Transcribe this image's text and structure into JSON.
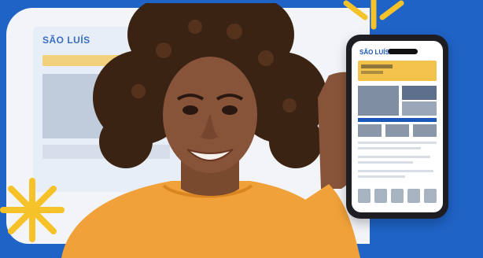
{
  "scene": {
    "background_color": "#1f63c6",
    "panel_color": "#f2f4f8",
    "accent_color": "#f6c229",
    "sweater_color": "#f0a13a"
  },
  "website": {
    "logo_text": "SÃO LUÍS"
  },
  "phone": {
    "logo_text": "SÃO LUÍS"
  }
}
